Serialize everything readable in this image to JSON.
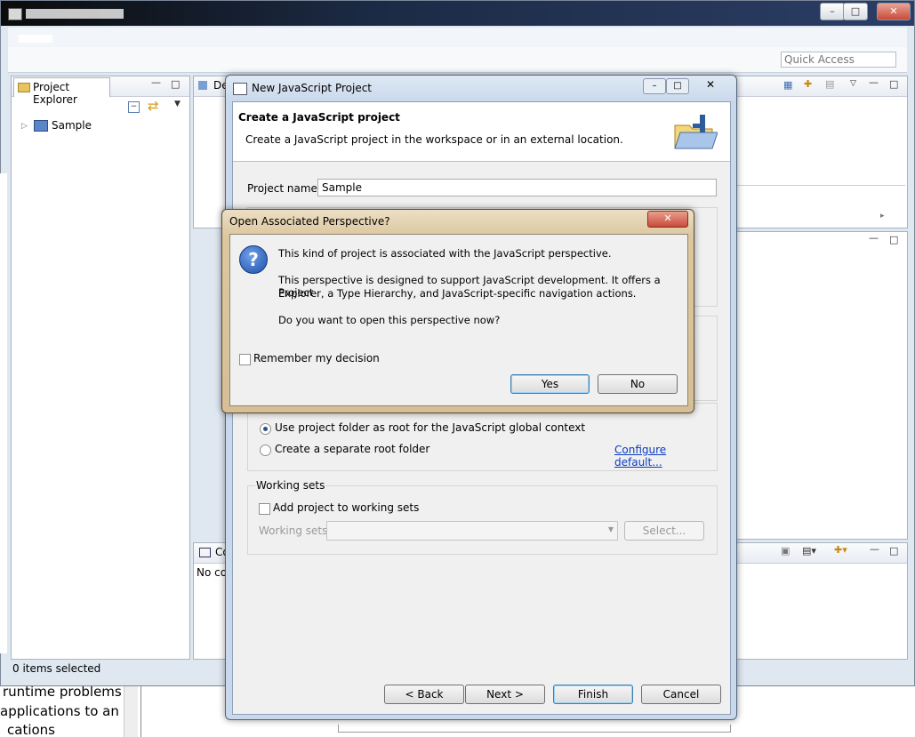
{
  "workbench": {
    "quick_access_placeholder": "Quick Access",
    "explorer_tab": "Project Explorer",
    "tree_item": "Sample",
    "status": "0 items selected",
    "other_tab_fragment": "De",
    "console_tab_fragment": "Co",
    "console_text_fragment": "No co"
  },
  "background": {
    "line1": "runtime problems",
    "line2": "applications to an i",
    "line3": "cations"
  },
  "wizard": {
    "title": "New JavaScript Project",
    "heading": "Create a JavaScript project",
    "description": "Create a JavaScript project in the workspace or in an external location.",
    "project_name_label": "Project name:",
    "project_name_value": "Sample",
    "radio_use_folder": "Use project folder as root for the JavaScript global context",
    "radio_separate": "Create a separate root folder",
    "configure_link": "Configure default...",
    "working_sets_group": "Working sets",
    "add_to_working_sets": "Add project to working sets",
    "working_sets_label": "Working sets:",
    "select_button": "Select...",
    "back_button": "< Back",
    "next_button": "Next >",
    "finish_button": "Finish",
    "cancel_button": "Cancel"
  },
  "perspective_dialog": {
    "title": "Open Associated Perspective?",
    "line1": "This kind of project is associated with the JavaScript perspective.",
    "line2a": "This perspective is designed to support JavaScript development. It offers a Project",
    "line2b": "Explorer, a Type Hierarchy, and JavaScript-specific navigation actions.",
    "line3": "Do you want to open this perspective now?",
    "remember_label": "Remember my decision",
    "yes_button": "Yes",
    "no_button": "No",
    "close_glyph": "✕"
  },
  "colors": {
    "link": "#0a3cc2",
    "close_red": "#c94a3a",
    "accent_blue": "#3c7fb1"
  }
}
